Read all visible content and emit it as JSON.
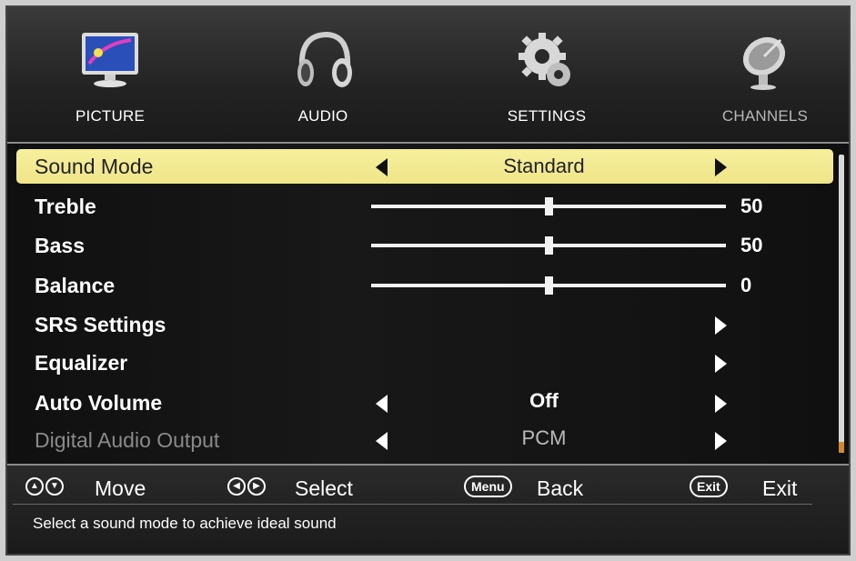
{
  "tabs": [
    {
      "label": "PICTURE",
      "icon": "monitor-icon",
      "state": "normal"
    },
    {
      "label": "AUDIO",
      "icon": "headphones-icon",
      "state": "active"
    },
    {
      "label": "SETTINGS",
      "icon": "gear-icon",
      "state": "normal"
    },
    {
      "label": "CHANNELS",
      "icon": "satellite-dish-icon",
      "state": "dim"
    }
  ],
  "menu": {
    "sound_mode": {
      "label": "Sound Mode",
      "value": "Standard"
    },
    "treble": {
      "label": "Treble",
      "value": "50",
      "level": 0.5
    },
    "bass": {
      "label": "Bass",
      "value": "50",
      "level": 0.5
    },
    "balance": {
      "label": "Balance",
      "value": "0",
      "level": 0.5
    },
    "srs": {
      "label": "SRS Settings"
    },
    "equalizer": {
      "label": "Equalizer"
    },
    "auto_volume": {
      "label": "Auto Volume",
      "value": "Off"
    },
    "digital_audio": {
      "label": "Digital Audio Output",
      "value": "PCM"
    }
  },
  "help": {
    "move": "Move",
    "select": "Select",
    "menu_key": "Menu",
    "back": "Back",
    "exit_key": "Exit",
    "exit": "Exit",
    "description": "Select a sound mode to achieve ideal sound"
  },
  "colors": {
    "active_tab": "#f2ef2e",
    "highlight_row": "#f6ef9c",
    "scroll_thumb": "#d08a2c"
  }
}
